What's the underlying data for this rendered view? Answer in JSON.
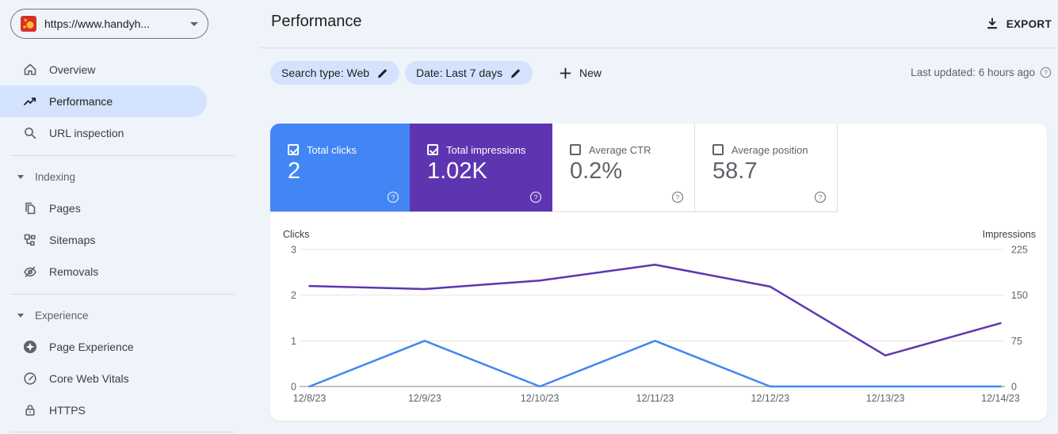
{
  "property_selector": {
    "url": "https://www.handyh..."
  },
  "sidebar": {
    "items": [
      {
        "label": "Overview",
        "icon": "home-icon",
        "selected": false
      },
      {
        "label": "Performance",
        "icon": "performance-icon",
        "selected": true
      },
      {
        "label": "URL inspection",
        "icon": "search-icon",
        "selected": false
      }
    ],
    "sections": [
      {
        "label": "Indexing",
        "items": [
          {
            "label": "Pages",
            "icon": "pages-icon"
          },
          {
            "label": "Sitemaps",
            "icon": "sitemaps-icon"
          },
          {
            "label": "Removals",
            "icon": "eye-off-icon"
          }
        ]
      },
      {
        "label": "Experience",
        "items": [
          {
            "label": "Page Experience",
            "icon": "page-experience-icon"
          },
          {
            "label": "Core Web Vitals",
            "icon": "gauge-icon"
          },
          {
            "label": "HTTPS",
            "icon": "lock-icon"
          }
        ]
      }
    ]
  },
  "header": {
    "title": "Performance",
    "export_label": "EXPORT"
  },
  "filters": {
    "search_type_chip": "Search type: Web",
    "date_chip": "Date: Last 7 days",
    "new_label": "New",
    "last_updated": "Last updated: 6 hours ago"
  },
  "metrics": [
    {
      "label": "Total clicks",
      "value": "2",
      "selected": true,
      "color": "#4285f4"
    },
    {
      "label": "Total impressions",
      "value": "1.02K",
      "selected": true,
      "color": "#5e35b1"
    },
    {
      "label": "Average CTR",
      "value": "0.2%",
      "selected": false,
      "color": ""
    },
    {
      "label": "Average position",
      "value": "58.7",
      "selected": false,
      "color": ""
    }
  ],
  "chart_data": {
    "type": "line",
    "x": [
      "12/8/23",
      "12/9/23",
      "12/10/23",
      "12/11/23",
      "12/12/23",
      "12/13/23",
      "12/14/23"
    ],
    "series": [
      {
        "name": "Clicks",
        "color": "#4285f4",
        "axis": "left",
        "values": [
          0,
          1,
          0,
          1,
          0,
          0,
          0
        ]
      },
      {
        "name": "Impressions",
        "color": "#5e35b1",
        "axis": "right",
        "values": [
          165,
          160,
          174,
          200,
          164,
          51,
          104
        ]
      }
    ],
    "left_axis": {
      "label": "Clicks",
      "ticks": [
        0,
        1,
        2,
        3
      ],
      "max": 3
    },
    "right_axis": {
      "label": "Impressions",
      "ticks": [
        0,
        75,
        150,
        225
      ],
      "max": 225
    },
    "grid": true,
    "legend": "none"
  }
}
